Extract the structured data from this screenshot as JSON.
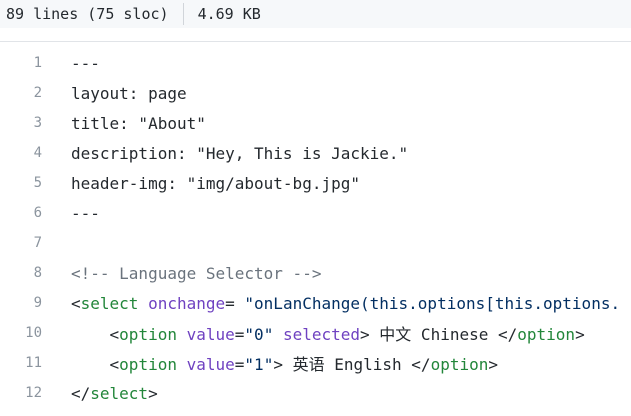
{
  "file_info": {
    "lines": "89 lines (75 sloc)",
    "size": "4.69 KB"
  },
  "code_lines": [
    {
      "number": "1",
      "text": "---"
    },
    {
      "number": "2",
      "text": "layout: page"
    },
    {
      "number": "3",
      "text": "title: \"About\""
    },
    {
      "number": "4",
      "text": "description: \"Hey, This is Jackie.\""
    },
    {
      "number": "5",
      "text": "header-img: \"img/about-bg.jpg\""
    },
    {
      "number": "6",
      "text": "---"
    },
    {
      "number": "7",
      "text": ""
    },
    {
      "number": "8",
      "text": "<!-- Language Selector -->"
    },
    {
      "number": "9",
      "parts": {
        "p1": "<",
        "p2": "select",
        "p3": " ",
        "p4": "onchange",
        "p5": "= ",
        "p6": "\"onLanChange(this.options[this.options."
      }
    },
    {
      "number": "10",
      "parts": {
        "p1": "    <",
        "p2": "option",
        "p3": " ",
        "p4": "value",
        "p5": "=",
        "p6": "\"0\"",
        "p7": " ",
        "p8": "selected",
        "p9": "> 中文 Chinese </",
        "p10": "option",
        "p11": ">"
      }
    },
    {
      "number": "11",
      "parts": {
        "p1": "    <",
        "p2": "option",
        "p3": " ",
        "p4": "value",
        "p5": "=",
        "p6": "\"1\"",
        "p7": "> 英语 English </",
        "p8": "option",
        "p9": ">"
      }
    },
    {
      "number": "12",
      "parts": {
        "p1": "</",
        "p2": "select",
        "p3": ">"
      }
    }
  ]
}
